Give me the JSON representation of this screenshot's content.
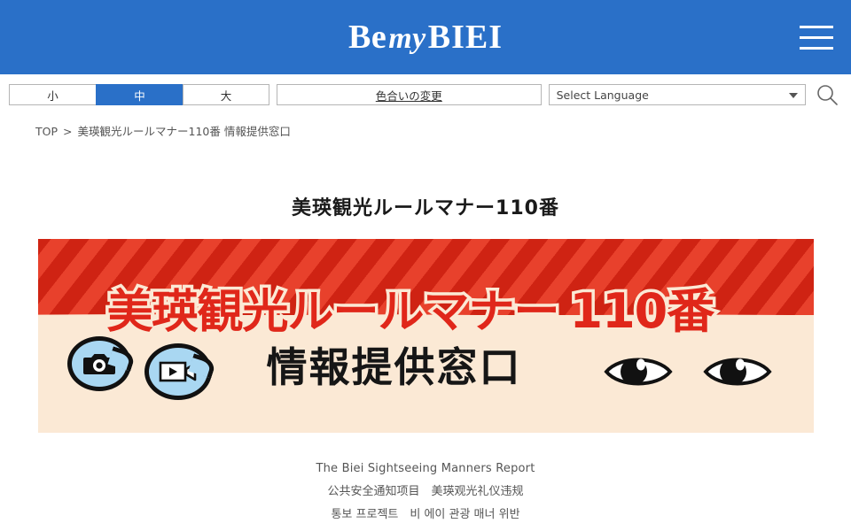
{
  "header": {
    "logo": {
      "be": "Be",
      "my": "my",
      "biei": "BIEI"
    },
    "menu_icon": "hamburger-icon"
  },
  "utility_bar": {
    "text_size": {
      "options": [
        {
          "label": "小",
          "selected": false
        },
        {
          "label": "中",
          "selected": true
        },
        {
          "label": "大",
          "selected": false
        }
      ]
    },
    "color_change_label": "色合いの変更",
    "language_select": {
      "value": "Select Language",
      "options": [
        "Select Language"
      ]
    },
    "search_icon": "search-icon"
  },
  "breadcrumb": {
    "home": "TOP",
    "separator": ">",
    "current": "美瑛観光ルールマナー110番 情報提供窓口"
  },
  "main": {
    "page_title": "美瑛観光ルールマナー110番",
    "banner": {
      "title_main": "美瑛観光ルールマナー",
      "title_number": "110番",
      "title_sub": "情報提供窓口",
      "icons": [
        "camera-bubble-icon",
        "video-bubble-icon",
        "eye-icon",
        "eye-icon"
      ]
    },
    "captions": [
      "The Biei Sightseeing Manners Report",
      "公共安全通知项目　美瑛观光礼仪违规",
      "통보 프로젝트　비 에이 관광 매너 위반"
    ]
  },
  "colors": {
    "brand_blue": "#2a70c8",
    "banner_red": "#e0271a",
    "banner_cream": "#fbe9d5",
    "bubble_blue": "#a9d7f2"
  }
}
